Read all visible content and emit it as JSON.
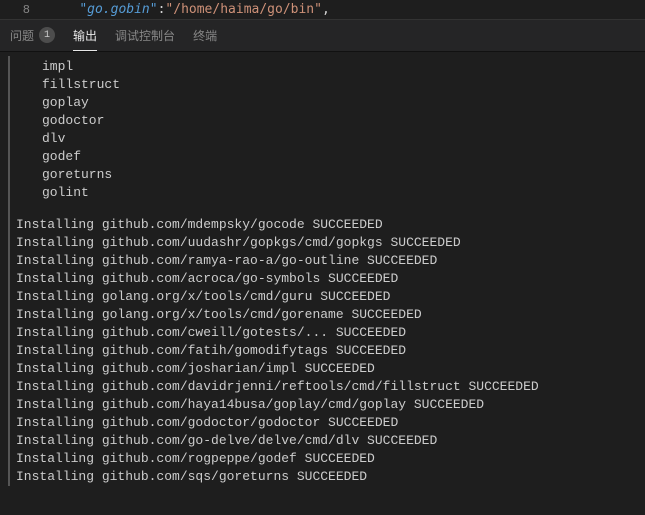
{
  "editor": {
    "line_number": "8",
    "json_key": "\"go.gobin\"",
    "json_colon": ":",
    "json_value": "\"/home/haima/go/bin\"",
    "trailing": ","
  },
  "tabs": {
    "problems": "问题",
    "problems_count": "1",
    "output": "输出",
    "debug_console": "调试控制台",
    "terminal": "终端"
  },
  "tools": [
    "impl",
    "fillstruct",
    "goplay",
    "godoctor",
    "dlv",
    "godef",
    "goreturns",
    "golint"
  ],
  "installs": [
    "Installing github.com/mdempsky/gocode SUCCEEDED",
    "Installing github.com/uudashr/gopkgs/cmd/gopkgs SUCCEEDED",
    "Installing github.com/ramya-rao-a/go-outline SUCCEEDED",
    "Installing github.com/acroca/go-symbols SUCCEEDED",
    "Installing golang.org/x/tools/cmd/guru SUCCEEDED",
    "Installing golang.org/x/tools/cmd/gorename SUCCEEDED",
    "Installing github.com/cweill/gotests/... SUCCEEDED",
    "Installing github.com/fatih/gomodifytags SUCCEEDED",
    "Installing github.com/josharian/impl SUCCEEDED",
    "Installing github.com/davidrjenni/reftools/cmd/fillstruct SUCCEEDED",
    "Installing github.com/haya14busa/goplay/cmd/goplay SUCCEEDED",
    "Installing github.com/godoctor/godoctor SUCCEEDED",
    "Installing github.com/go-delve/delve/cmd/dlv SUCCEEDED",
    "Installing github.com/rogpeppe/godef SUCCEEDED",
    "Installing github.com/sqs/goreturns SUCCEEDED"
  ]
}
